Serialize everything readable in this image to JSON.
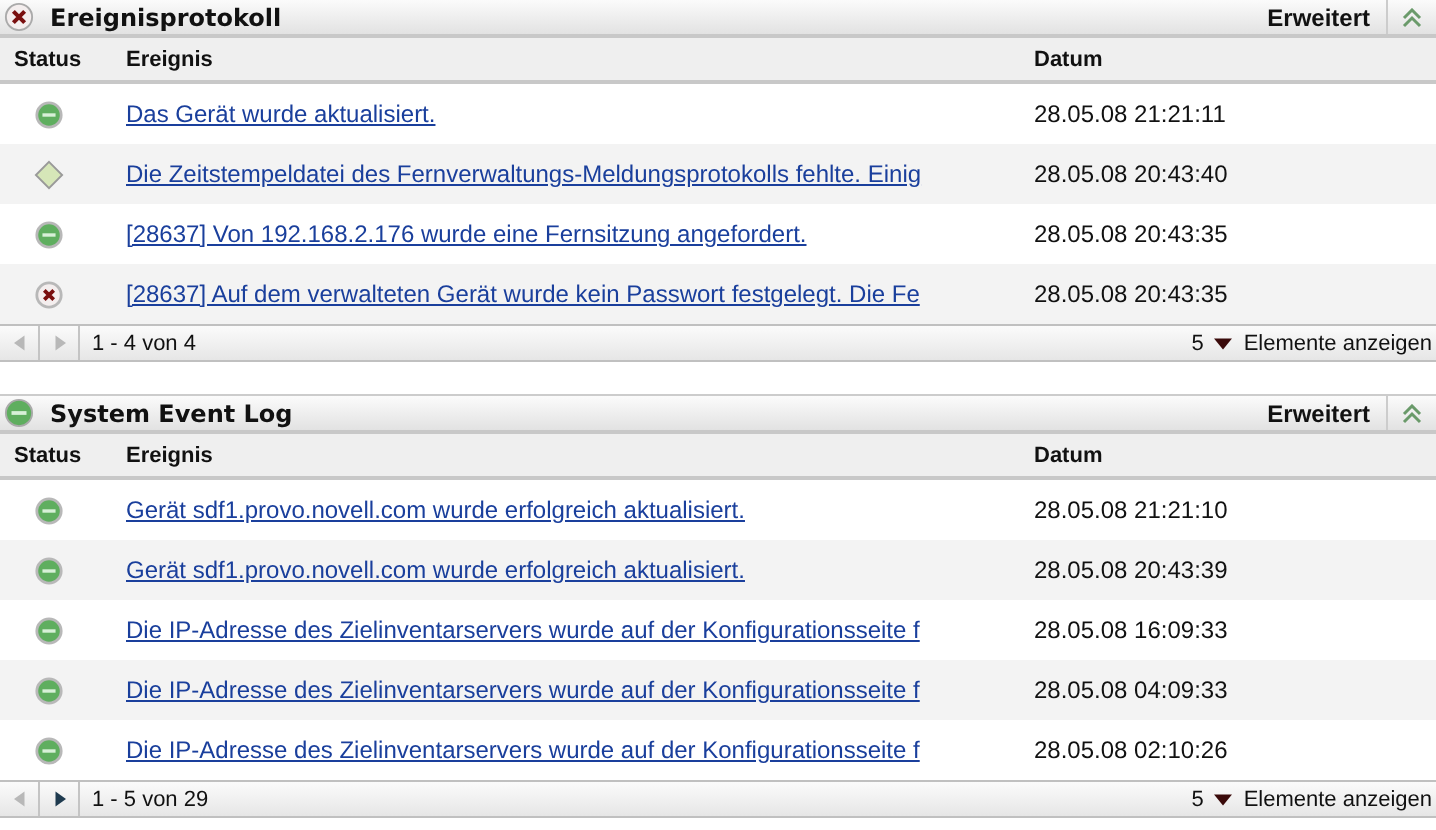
{
  "panels": [
    {
      "title": "Ereignisprotokoll",
      "kind": "error",
      "advanced_label": "Erweitert",
      "columns": [
        "Status",
        "Ereignis",
        "Datum"
      ],
      "rows": [
        {
          "kind": "ok",
          "event": "Das Gerät wurde aktualisiert.",
          "date": "28.05.08 21:21:11"
        },
        {
          "kind": "warning",
          "event": "Die Zeitstempeldatei des Fernverwaltungs-Meldungsprotokolls fehlte. Einig",
          "date": "28.05.08 20:43:40"
        },
        {
          "kind": "ok",
          "event": "[28637] Von 192.168.2.176 wurde eine Fernsitzung angefordert.",
          "date": "28.05.08 20:43:35"
        },
        {
          "kind": "error",
          "event": "[28637] Auf dem verwalteten Gerät wurde kein Passwort festgelegt. Die Fe",
          "date": "28.05.08 20:43:35"
        }
      ],
      "footer": {
        "prev_disabled": true,
        "next_disabled": true,
        "range": "1 - 4 von 4",
        "page_size": "5",
        "page_size_label": "Elemente anzeigen"
      }
    },
    {
      "title": "System Event Log",
      "kind": "ok",
      "advanced_label": "Erweitert",
      "columns": [
        "Status",
        "Ereignis",
        "Datum"
      ],
      "rows": [
        {
          "kind": "ok",
          "event": "Gerät sdf1.provo.novell.com wurde erfolgreich aktualisiert.",
          "date": "28.05.08 21:21:10"
        },
        {
          "kind": "ok",
          "event": "Gerät sdf1.provo.novell.com wurde erfolgreich aktualisiert.",
          "date": "28.05.08 20:43:39"
        },
        {
          "kind": "ok",
          "event": "Die IP-Adresse des Zielinventarservers wurde auf der Konfigurationsseite f",
          "date": "28.05.08 16:09:33"
        },
        {
          "kind": "ok",
          "event": "Die IP-Adresse des Zielinventarservers wurde auf der Konfigurationsseite f",
          "date": "28.05.08 04:09:33"
        },
        {
          "kind": "ok",
          "event": "Die IP-Adresse des Zielinventarservers wurde auf der Konfigurationsseite f",
          "date": "28.05.08 02:10:26"
        }
      ],
      "footer": {
        "prev_disabled": true,
        "next_disabled": false,
        "range": "1 - 5 von 29",
        "page_size": "5",
        "page_size_label": "Elemente anzeigen"
      }
    }
  ]
}
